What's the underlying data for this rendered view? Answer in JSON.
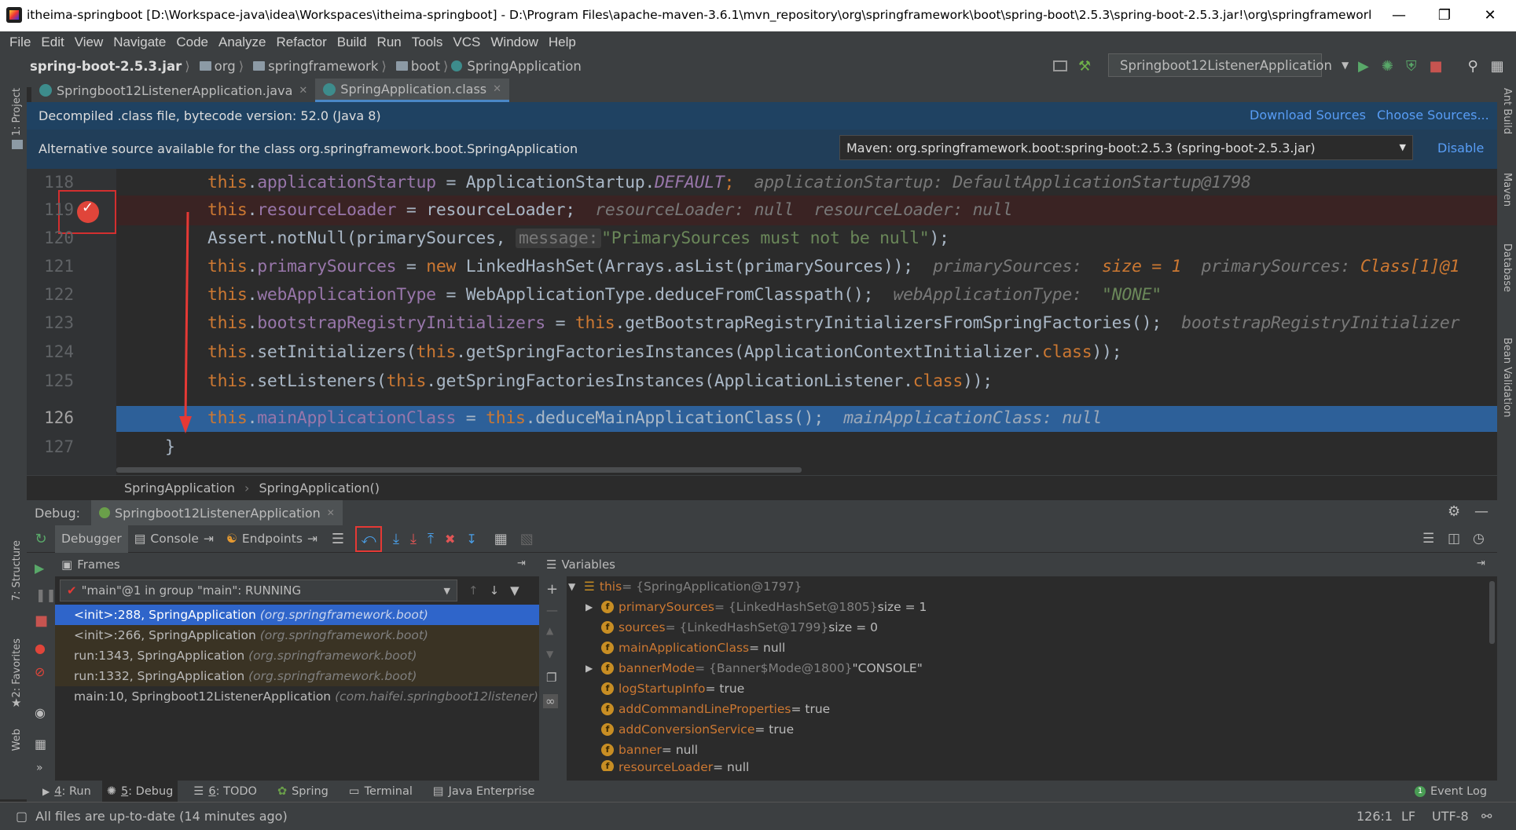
{
  "window": {
    "title": "itheima-springboot [D:\\Workspace-java\\idea\\Workspaces\\itheima-springboot] - D:\\Program Files\\apache-maven-3.6.1\\mvn_repository\\org\\springframework\\boot\\spring-boot\\2.5.3\\spring-boot-2.5.3.jar!\\org\\springframework\\boot\\S..."
  },
  "menu": [
    "File",
    "Edit",
    "View",
    "Navigate",
    "Code",
    "Analyze",
    "Refactor",
    "Build",
    "Run",
    "Tools",
    "VCS",
    "Window",
    "Help"
  ],
  "breadcrumb": [
    "spring-boot-2.5.3.jar",
    "org",
    "springframework",
    "boot",
    "SpringApplication"
  ],
  "run_config": "Springboot12ListenerApplication",
  "tabs": [
    {
      "label": "Springboot12ListenerApplication.java"
    },
    {
      "label": "SpringApplication.class"
    }
  ],
  "banner1": {
    "text": "Decompiled .class file, bytecode version: 52.0 (Java 8)",
    "download": "Download Sources",
    "choose": "Choose Sources..."
  },
  "banner2": {
    "text": "Alternative source available for the class org.springframework.boot.SpringApplication",
    "select": "Maven: org.springframework.boot:spring-boot:2.5.3 (spring-boot-2.5.3.jar)",
    "disable": "Disable"
  },
  "lines": [
    "118",
    "119",
    "120",
    "121",
    "122",
    "123",
    "124",
    "125",
    "126",
    "127"
  ],
  "code": {
    "l118": {
      "this": "this",
      "a": ".",
      "f": "applicationStartup",
      "b": " = ApplicationStartup.",
      "c": "DEFAULT",
      "d": ";",
      "h": "applicationStartup: DefaultApplicationStartup@1798"
    },
    "l119": {
      "this": "this",
      "a": ".",
      "f": "resourceLoader",
      "b": " = resourceLoader;",
      "h": "resourceLoader: null  resourceLoader: null"
    },
    "l120": {
      "a": "Assert.notNull(primarySources, ",
      "lbl": "message:",
      "s": "\"PrimarySources must not be null\"",
      "b": ");"
    },
    "l121": {
      "this": "this",
      "a": ".",
      "f": "primarySources",
      "b": " = ",
      "n": "new",
      "c": " LinkedHashSet(Arrays.asList(primarySources));",
      "h1": "primarySources:",
      "h2": "size = 1",
      "h3": "primarySources:",
      "h4": "Class[1]@1"
    },
    "l122": {
      "this": "this",
      "a": ".",
      "f": "webApplicationType",
      "b": " = WebApplicationType.deduceFromClasspath();",
      "h1": "webApplicationType:",
      "h2": "\"NONE\""
    },
    "l123": {
      "this": "this",
      "a": ".",
      "f": "bootstrapRegistryInitializers",
      "b": " = ",
      "this2": "this",
      "c": ".getBootstrapRegistryInitializersFromSpringFactories();",
      "h": "bootstrapRegistryInitializer"
    },
    "l124": {
      "this": "this",
      "a": ".setInitializers(",
      "this2": "this",
      "b": ".getSpringFactoriesInstances(ApplicationContextInitializer.",
      "cl": "class",
      "c": "));"
    },
    "l125": {
      "this": "this",
      "a": ".setListeners(",
      "this2": "this",
      "b": ".getSpringFactoriesInstances(ApplicationListener.",
      "cl": "class",
      "c": "));"
    },
    "l126": {
      "this": "this",
      "a": ".",
      "f": "mainApplicationClass",
      "b": " = ",
      "this2": "this",
      "c": ".deduceMainApplicationClass();",
      "h": "mainApplicationClass: null"
    },
    "l127": {
      "a": "}"
    }
  },
  "editor_breadcrumb": [
    "SpringApplication",
    "SpringApplication()"
  ],
  "debug": {
    "label": "Debug:",
    "session": "Springboot12ListenerApplication",
    "tabs": [
      "Debugger",
      "Console",
      "Endpoints"
    ]
  },
  "frames": {
    "title": "Frames",
    "thread": "\"main\"@1 in group \"main\": RUNNING",
    "items": [
      {
        "m": "<init>:288, SpringApplication",
        "p": "(org.springframework.boot)"
      },
      {
        "m": "<init>:266, SpringApplication",
        "p": "(org.springframework.boot)"
      },
      {
        "m": "run:1343, SpringApplication",
        "p": "(org.springframework.boot)"
      },
      {
        "m": "run:1332, SpringApplication",
        "p": "(org.springframework.boot)"
      },
      {
        "m": "main:10, Springboot12ListenerApplication",
        "p": "(com.haifei.springboot12listener)"
      }
    ]
  },
  "variables": {
    "title": "Variables",
    "items": [
      {
        "n": "this",
        "v": " = {SpringApplication@1797}"
      },
      {
        "n": "primarySources",
        "v": " = {LinkedHashSet@1805}",
        "x": "  size = 1"
      },
      {
        "n": "sources",
        "v": " = {LinkedHashSet@1799}",
        "x": "  size = 0"
      },
      {
        "n": "mainApplicationClass",
        "v": "",
        "x": " = null"
      },
      {
        "n": "bannerMode",
        "v": " = {Banner$Mode@1800}",
        "x": " \"CONSOLE\""
      },
      {
        "n": "logStartupInfo",
        "v": "",
        "x": " = true"
      },
      {
        "n": "addCommandLineProperties",
        "v": "",
        "x": " = true"
      },
      {
        "n": "addConversionService",
        "v": "",
        "x": " = true"
      },
      {
        "n": "banner",
        "v": "",
        "x": " = null"
      },
      {
        "n": "resourceLoader",
        "v": "",
        "x": " = null"
      }
    ]
  },
  "left_tools": [
    "1: Project",
    "7: Structure",
    "2: Favorites",
    "Web"
  ],
  "right_tools": [
    "Ant Build",
    "Maven",
    "Database",
    "Bean Validation"
  ],
  "bottom_tabs": [
    {
      "k": "4",
      "l": ": Run"
    },
    {
      "k": "5",
      "l": ": Debug"
    },
    {
      "k": "6",
      "l": ": TODO"
    },
    {
      "k": "",
      "l": "Spring"
    },
    {
      "k": "",
      "l": "Terminal"
    },
    {
      "k": "",
      "l": "Java Enterprise"
    }
  ],
  "event_log": "Event Log",
  "status": {
    "msg": "All files are up-to-date (14 minutes ago)",
    "pos": "126:1",
    "sep": "LF",
    "enc": "UTF-8"
  }
}
